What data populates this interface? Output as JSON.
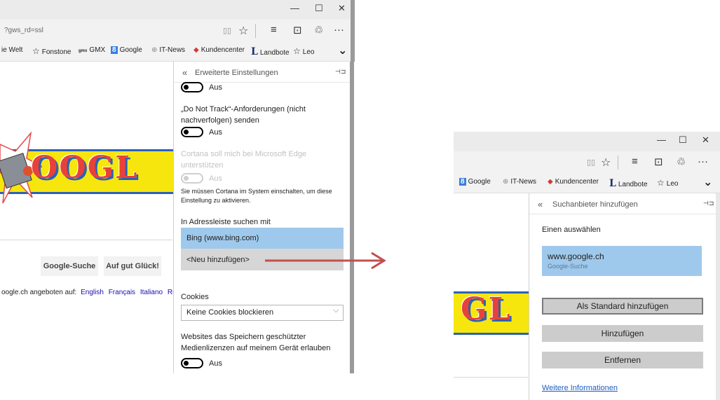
{
  "left": {
    "window_controls": [
      "—",
      "☐",
      "✕"
    ],
    "address_text": "?gws_rd=ssl",
    "toolbar_icons": [
      "reading-view-icon",
      "favorite-star-icon",
      "hub-icon",
      "web-note-icon",
      "share-icon",
      "more-icon"
    ],
    "toolbar_glyphs": [
      "▯▯",
      "☆",
      "≡",
      "⊡",
      "♲",
      "···"
    ],
    "favorites": [
      {
        "label": "ie Welt",
        "icon": ""
      },
      {
        "label": "Fonstone",
        "icon": "☆"
      },
      {
        "label": "GMX",
        "icon": "gmx"
      },
      {
        "label": "Google",
        "icon": "8"
      },
      {
        "label": "IT-News",
        "icon": "⊕"
      },
      {
        "label": "Kundencenter",
        "icon": "◆"
      },
      {
        "label": "Landbote",
        "icon": "L"
      },
      {
        "label": "Leo",
        "icon": "☆"
      }
    ],
    "favorites_chevron": "⌄",
    "google_doodle_text": "OOGL",
    "google_search_button": "Google-Suche",
    "lucky_button": "Auf gut Glück!",
    "offered_in_text": "oogle.ch angeboten auf:",
    "languages": [
      "English",
      "Français",
      "Italiano",
      "Ru"
    ],
    "panel": {
      "back": "«",
      "title": "Erweiterte Einstellungen",
      "pin": "⊣⊐",
      "toggle1_label": "Aus",
      "dnt_text_line1": "„Do Not Track“-Anforderungen (nicht",
      "dnt_text_line2": "nachverfolgen) senden",
      "toggle2_label": "Aus",
      "cortana_line1": "Cortana soll mich bei Microsoft Edge",
      "cortana_line2": "unterstützen",
      "toggle3_label": "Aus",
      "cortana_note_line1": "Sie müssen Cortana im System einschalten, um diese",
      "cortana_note_line2": "Einstellung zu aktivieren.",
      "search_label": "In Adressleiste suchen mit",
      "search_options": [
        "Bing (www.bing.com)",
        "<Neu hinzufügen>"
      ],
      "cookies_label": "Cookies",
      "cookies_value": "Keine Cookies blockieren",
      "licenses_line1": "Websites das Speichern geschützter",
      "licenses_line2": "Medienlizenzen auf meinem Gerät erlauben",
      "toggle4_label": "Aus"
    }
  },
  "right": {
    "window_controls": [
      "—",
      "☐",
      "✕"
    ],
    "toolbar_glyphs": [
      "▯▯",
      "☆",
      "≡",
      "⊡",
      "♲",
      "···"
    ],
    "favorites": [
      {
        "label": "Google",
        "icon": "8"
      },
      {
        "label": "IT-News",
        "icon": "⊕"
      },
      {
        "label": "Kundencenter",
        "icon": "◆"
      },
      {
        "label": "Landbote",
        "icon": "L"
      },
      {
        "label": "Leo",
        "icon": "☆"
      }
    ],
    "favorites_chevron": "⌄",
    "google_doodle_text": "GL",
    "panel": {
      "back": "«",
      "title": "Suchanbieter hinzufügen",
      "pin": "⊣⊐",
      "choose_label": "Einen auswählen",
      "provider_name": "www.google.ch",
      "provider_sub": "Google-Suche",
      "set_default_button": "Als Standard hinzufügen",
      "add_button": "Hinzufügen",
      "remove_button": "Entfernen",
      "more_info_link": "Weitere Informationen"
    }
  },
  "colors": {
    "selection_blue": "#9fc9ec",
    "arrow_red": "#c0504d",
    "scroll_grey": "#9a9a9a",
    "link_blue": "#1a5ec2"
  }
}
